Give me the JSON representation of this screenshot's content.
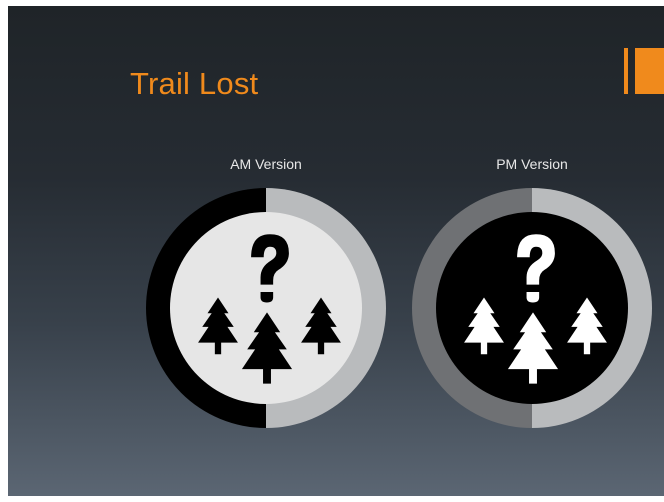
{
  "slide": {
    "title": "Trail Lost",
    "accent_color": "#f08a1c",
    "background_top": "#1f2428",
    "background_bottom": "#5b6673"
  },
  "versions": [
    {
      "label": "AM Version",
      "icon": "question-mark-with-pine-trees",
      "ring_left_color": "#000000",
      "ring_right_color": "#b9bbbd",
      "inner_color": "#e6e6e6",
      "glyph_color": "#000000"
    },
    {
      "label": "PM Version",
      "icon": "question-mark-with-pine-trees",
      "ring_left_color": "#6f7174",
      "ring_right_color": "#b9bbbd",
      "inner_color": "#000000",
      "glyph_color": "#ffffff"
    }
  ]
}
